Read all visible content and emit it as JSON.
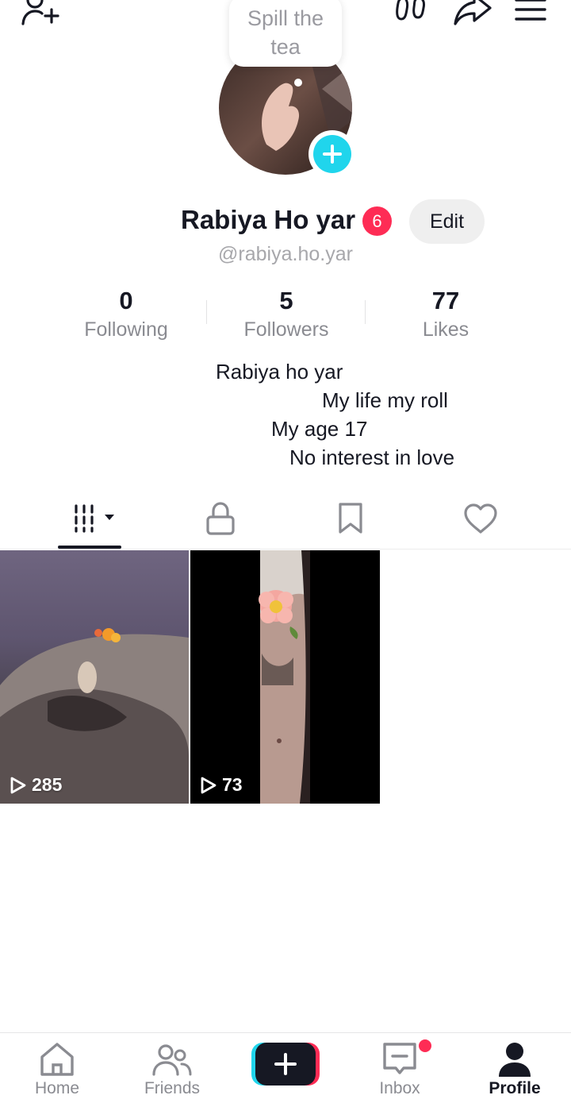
{
  "tooltip": {
    "text": "Spill the tea"
  },
  "profile": {
    "display_name": "Rabiya Ho yar",
    "notification_count": "6",
    "edit_label": "Edit",
    "handle": "@rabiya.ho.yar"
  },
  "stats": [
    {
      "value": "0",
      "label": "Following"
    },
    {
      "value": "5",
      "label": "Followers"
    },
    {
      "value": "77",
      "label": "Likes"
    }
  ],
  "bio": [
    "Rabiya ho yar",
    "My life my roll",
    "My age 17",
    "No interest in love"
  ],
  "tabs": [
    {
      "icon": "videos-grid-icon",
      "active": true
    },
    {
      "icon": "lock-icon",
      "active": false
    },
    {
      "icon": "bookmark-icon",
      "active": false
    },
    {
      "icon": "heart-icon",
      "active": false
    }
  ],
  "videos": [
    {
      "views": "285"
    },
    {
      "views": "73"
    }
  ],
  "nav": {
    "home": "Home",
    "friends": "Friends",
    "inbox": "Inbox",
    "profile": "Profile"
  },
  "colors": {
    "accent_red": "#fe2c55",
    "accent_cyan": "#20d5ec",
    "text_primary": "#161823",
    "text_secondary": "#8a8b91"
  }
}
